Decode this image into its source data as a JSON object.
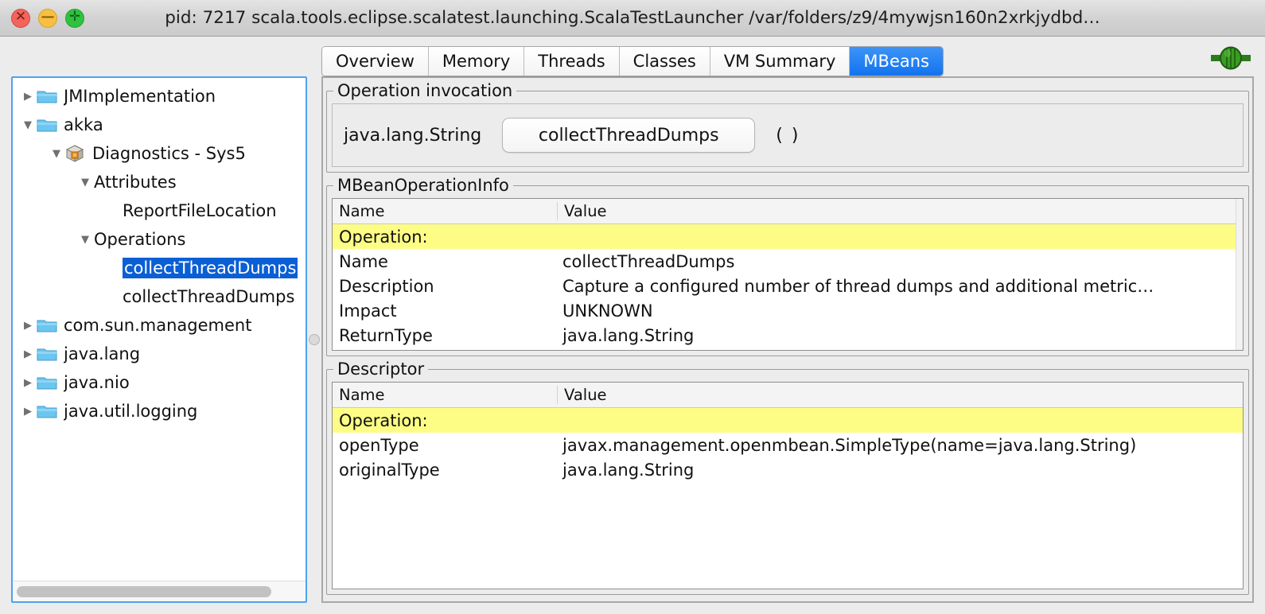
{
  "window": {
    "title": "pid: 7217 scala.tools.eclipse.scalatest.launching.ScalaTestLauncher /var/folders/z9/4mywjsn160n2xrkjydbd…",
    "close_glyph": "✕",
    "minimize_glyph": "—",
    "maximize_glyph": "✛",
    "accent_blue": "#1273ef",
    "highlight_yellow": "#fdfd86",
    "selection_blue": "#0a5fd4"
  },
  "tabs": [
    {
      "label": "Overview",
      "active": false
    },
    {
      "label": "Memory",
      "active": false
    },
    {
      "label": "Threads",
      "active": false
    },
    {
      "label": "Classes",
      "active": false
    },
    {
      "label": "VM Summary",
      "active": false
    },
    {
      "label": "MBeans",
      "active": true
    }
  ],
  "connection_icon": "plug-connected-icon",
  "tree": {
    "items": [
      {
        "label": "JMImplementation",
        "indent": 0,
        "twist": "collapsed",
        "icon": "folder-icon",
        "selected": false
      },
      {
        "label": "akka",
        "indent": 0,
        "twist": "expanded",
        "icon": "folder-icon",
        "selected": false
      },
      {
        "label": "Diagnostics - Sys5",
        "indent": 1,
        "twist": "expanded",
        "icon": "mbean-icon",
        "selected": false
      },
      {
        "label": "Attributes",
        "indent": 2,
        "twist": "expanded",
        "icon": "none",
        "selected": false
      },
      {
        "label": "ReportFileLocation",
        "indent": 3,
        "twist": "none",
        "icon": "none",
        "selected": false
      },
      {
        "label": "Operations",
        "indent": 2,
        "twist": "expanded",
        "icon": "none",
        "selected": false
      },
      {
        "label": "collectThreadDumps",
        "indent": 3,
        "twist": "none",
        "icon": "none",
        "selected": true
      },
      {
        "label": "collectThreadDumps",
        "indent": 3,
        "twist": "none",
        "icon": "none",
        "selected": false
      },
      {
        "label": "com.sun.management",
        "indent": 0,
        "twist": "collapsed",
        "icon": "folder-icon",
        "selected": false
      },
      {
        "label": "java.lang",
        "indent": 0,
        "twist": "collapsed",
        "icon": "folder-icon",
        "selected": false
      },
      {
        "label": "java.nio",
        "indent": 0,
        "twist": "collapsed",
        "icon": "folder-icon",
        "selected": false
      },
      {
        "label": "java.util.logging",
        "indent": 0,
        "twist": "collapsed",
        "icon": "folder-icon",
        "selected": false
      }
    ]
  },
  "operation_invocation": {
    "legend": "Operation invocation",
    "return_type": "java.lang.String",
    "button_label": "collectThreadDumps",
    "parameters": "( )"
  },
  "mbean_operation_info": {
    "legend": "MBeanOperationInfo",
    "columns": {
      "name": "Name",
      "value": "Value"
    },
    "rows": [
      {
        "name": "Operation:",
        "value": "",
        "highlight": true
      },
      {
        "name": "Name",
        "value": "collectThreadDumps",
        "highlight": false
      },
      {
        "name": "Description",
        "value": "Capture a configured number of thread dumps and additional metric…",
        "highlight": false
      },
      {
        "name": "Impact",
        "value": "UNKNOWN",
        "highlight": false
      },
      {
        "name": "ReturnType",
        "value": "java.lang.String",
        "highlight": false
      }
    ]
  },
  "descriptor": {
    "legend": "Descriptor",
    "columns": {
      "name": "Name",
      "value": "Value"
    },
    "rows": [
      {
        "name": "Operation:",
        "value": "",
        "highlight": true
      },
      {
        "name": "openType",
        "value": "javax.management.openmbean.SimpleType(name=java.lang.String)",
        "highlight": false
      },
      {
        "name": "originalType",
        "value": "java.lang.String",
        "highlight": false
      }
    ]
  }
}
